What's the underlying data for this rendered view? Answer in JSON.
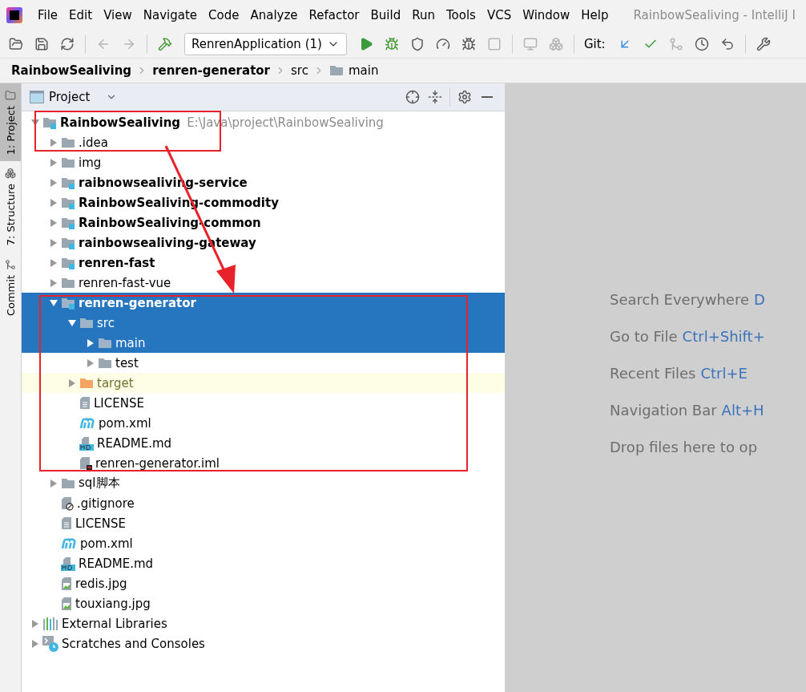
{
  "menu_bar": {
    "items": [
      "File",
      "Edit",
      "View",
      "Navigate",
      "Code",
      "Analyze",
      "Refactor",
      "Build",
      "Run",
      "Tools",
      "VCS",
      "Window",
      "Help"
    ],
    "title": "RainbowSealiving - IntelliJ I"
  },
  "toolbar": {
    "left_buttons": [
      {
        "kind": "open",
        "disabled": false
      },
      {
        "kind": "save",
        "disabled": false
      },
      {
        "kind": "sync",
        "disabled": false
      },
      {
        "kind": "back",
        "disabled": true
      },
      {
        "kind": "forward",
        "disabled": true
      },
      {
        "kind": "build",
        "disabled": false
      }
    ],
    "run_config": "RenrenApplication (1)",
    "right_buttons": [
      {
        "kind": "run",
        "disabled": false
      },
      {
        "kind": "debug",
        "disabled": false
      },
      {
        "kind": "coverage",
        "disabled": false
      },
      {
        "kind": "profile",
        "disabled": false
      },
      {
        "kind": "attach",
        "disabled": false
      },
      {
        "kind": "stop",
        "disabled": true
      },
      {
        "kind": "device",
        "disabled": true
      },
      {
        "kind": "boxes",
        "disabled": true
      }
    ],
    "git_label": "Git:",
    "git_buttons": [
      {
        "kind": "update",
        "disabled": false
      },
      {
        "kind": "commit",
        "disabled": false
      },
      {
        "kind": "merge",
        "disabled": true
      },
      {
        "kind": "history",
        "disabled": false
      },
      {
        "kind": "rollback",
        "disabled": false
      },
      {
        "kind": "settings",
        "disabled": false
      }
    ]
  },
  "breadcrumbs": [
    {
      "label": "RainbowSealiving",
      "kind": "module"
    },
    {
      "label": "renren-generator",
      "kind": "module"
    },
    {
      "label": "src",
      "kind": "plain"
    },
    {
      "label": "main",
      "kind": "folder"
    }
  ],
  "tool_strip": [
    {
      "label": "1: Project",
      "kind": "project",
      "selected": true
    },
    {
      "label": "7: Structure",
      "kind": "structure",
      "selected": false
    },
    {
      "label": "Commit",
      "kind": "commit",
      "selected": false
    }
  ],
  "project_panel": {
    "title": "Project",
    "tree": [
      {
        "label": "RainbowSealiving",
        "path": "E:\\Java\\project\\RainbowSealiving",
        "kind": "module",
        "expanded": true,
        "selected": false,
        "children": [
          {
            "label": ".idea",
            "kind": "folder",
            "expanded": false,
            "selected": false
          },
          {
            "label": "img",
            "kind": "folder",
            "expanded": false,
            "selected": false
          },
          {
            "label": "raibnowsealiving-service",
            "kind": "module",
            "expanded": false,
            "selected": false
          },
          {
            "label": "RainbowSealiving-commodity",
            "kind": "module",
            "expanded": false,
            "selected": false
          },
          {
            "label": "RainbowSealiving-common",
            "kind": "module",
            "expanded": false,
            "selected": false
          },
          {
            "label": "rainbowsealiving-gateway",
            "kind": "module",
            "expanded": false,
            "selected": false
          },
          {
            "label": "renren-fast",
            "kind": "module",
            "expanded": false,
            "selected": false
          },
          {
            "label": "renren-fast-vue",
            "kind": "folder",
            "expanded": false,
            "selected": false
          },
          {
            "label": "renren-generator",
            "kind": "module",
            "expanded": true,
            "selected": true,
            "children": [
              {
                "label": "src",
                "kind": "folder",
                "expanded": true,
                "selected": true,
                "children": [
                  {
                    "label": "main",
                    "kind": "folder",
                    "expanded": false,
                    "selected": true
                  },
                  {
                    "label": "test",
                    "kind": "folder",
                    "expanded": false,
                    "selected": false
                  }
                ]
              },
              {
                "label": "target",
                "kind": "excluded",
                "expanded": false,
                "selected": false
              },
              {
                "label": "LICENSE",
                "kind": "text",
                "selected": false
              },
              {
                "label": "pom.xml",
                "kind": "maven",
                "selected": false
              },
              {
                "label": "README.md",
                "kind": "markdown",
                "selected": false
              },
              {
                "label": "renren-generator.iml",
                "kind": "iml",
                "selected": false
              }
            ]
          },
          {
            "label": "sql脚本",
            "kind": "folder",
            "expanded": false,
            "selected": false
          },
          {
            "label": ".gitignore",
            "kind": "ignore",
            "selected": false
          },
          {
            "label": "LICENSE",
            "kind": "text",
            "selected": false
          },
          {
            "label": "pom.xml",
            "kind": "maven",
            "selected": false
          },
          {
            "label": "README.md",
            "kind": "markdown",
            "selected": false
          },
          {
            "label": "redis.jpg",
            "kind": "image",
            "selected": false
          },
          {
            "label": "touxiang.jpg",
            "kind": "image",
            "selected": false
          }
        ]
      },
      {
        "label": "External Libraries",
        "kind": "libraries",
        "expanded": false,
        "selected": false
      },
      {
        "label": "Scratches and Consoles",
        "kind": "scratches",
        "expanded": false,
        "selected": false
      }
    ]
  },
  "editor_hints": [
    {
      "label": "Search Everywhere",
      "shortcut": "D"
    },
    {
      "label": "Go to File",
      "shortcut": "Ctrl+Shift+"
    },
    {
      "label": "Recent Files",
      "shortcut": "Ctrl+E"
    },
    {
      "label": "Navigation Bar",
      "shortcut": "Alt+H"
    },
    {
      "label": "Drop files here to op"
    }
  ]
}
